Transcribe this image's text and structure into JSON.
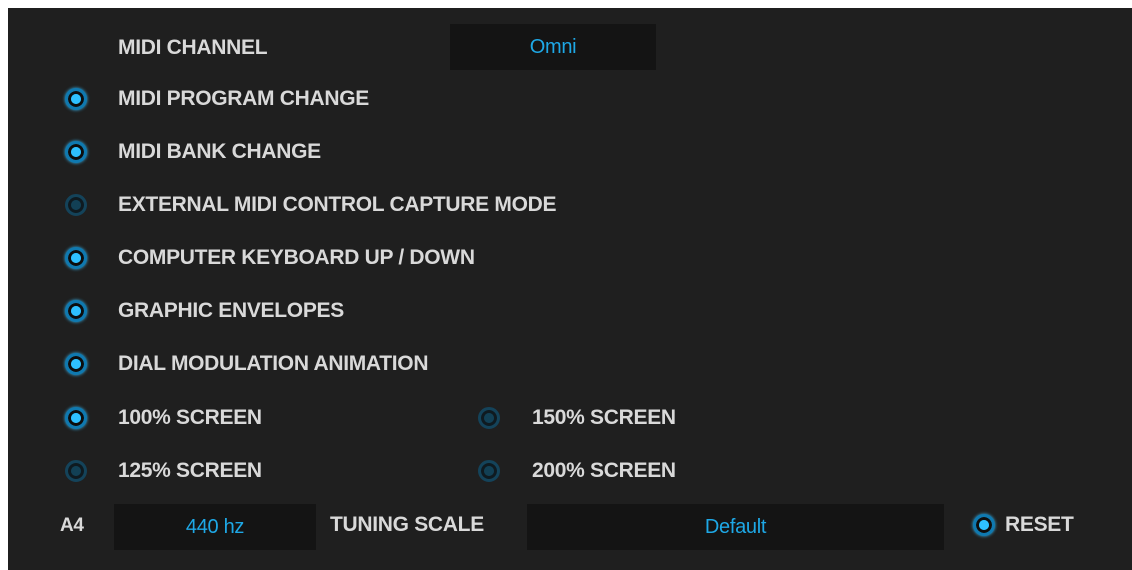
{
  "midi_channel": {
    "label": "MIDI CHANNEL",
    "value": "Omni"
  },
  "options": [
    {
      "label": "MIDI PROGRAM CHANGE",
      "enabled": true
    },
    {
      "label": "MIDI BANK CHANGE",
      "enabled": true
    },
    {
      "label": "EXTERNAL MIDI CONTROL CAPTURE MODE",
      "enabled": false
    },
    {
      "label": "COMPUTER KEYBOARD UP / DOWN",
      "enabled": true
    },
    {
      "label": "GRAPHIC ENVELOPES",
      "enabled": true
    },
    {
      "label": "DIAL MODULATION ANIMATION",
      "enabled": true
    }
  ],
  "screen_sizes": [
    {
      "label": "100% SCREEN",
      "selected": true
    },
    {
      "label": "125% SCREEN",
      "selected": false
    },
    {
      "label": "150% SCREEN",
      "selected": false
    },
    {
      "label": "200% SCREEN",
      "selected": false
    }
  ],
  "tuning": {
    "a4_label": "A4",
    "a4_value": "440 hz",
    "scale_label": "TUNING SCALE",
    "scale_value": "Default",
    "reset_label": "RESET"
  },
  "colors": {
    "background": "#1f1f1f",
    "text": "#d9d9d9",
    "accent": "#1ea8e6",
    "field": "#141414"
  }
}
